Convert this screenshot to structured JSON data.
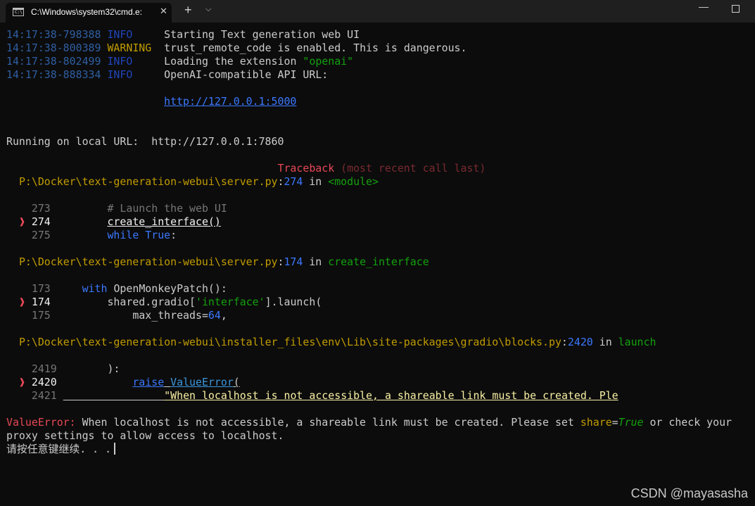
{
  "window": {
    "tab_title": "C:\\Windows\\system32\\cmd.e:",
    "tab_icon_text": "C:\\",
    "close_glyph": "✕",
    "newtab_glyph": "+",
    "dropdown_glyph": "⌵",
    "minimize_glyph": "—"
  },
  "log": [
    {
      "time": "14:17:38-798388",
      "level": "INFO",
      "msg": "Starting Text generation web UI"
    },
    {
      "time": "14:17:38-800389",
      "level": "WARNING",
      "msg": "trust_remote_code is enabled. This is dangerous."
    },
    {
      "time": "14:17:38-802499",
      "level": "INFO",
      "msg_prefix": "Loading the extension ",
      "msg_str": "\"openai\""
    },
    {
      "time": "14:17:38-888334",
      "level": "INFO",
      "msg": "OpenAI-compatible API URL:"
    }
  ],
  "api_url": "http://127.0.0.1:5000",
  "running": "Running on local URL:  http://127.0.0.1:7860",
  "traceback": {
    "title": "Traceback",
    "sub": "(most recent call last)"
  },
  "frames": [
    {
      "path": "P:\\Docker\\text-generation-webui\\server.py",
      "lineno": "274",
      "in": "in",
      "func": "<module>",
      "code": [
        {
          "n": "273",
          "text": "# Launch the web UI"
        },
        {
          "n": "274",
          "text": "create_interface()"
        },
        {
          "n": "275",
          "kw": "while",
          "rest": "True",
          "colon": ":"
        }
      ]
    },
    {
      "path": "P:\\Docker\\text-generation-webui\\server.py",
      "lineno": "174",
      "in": "in",
      "func": "create_interface",
      "code": [
        {
          "n": "173",
          "kw": "with",
          "rest": "OpenMonkeyPatch():"
        },
        {
          "n": "174",
          "a": "shared.gradio[",
          "s": "'interface'",
          "b": "].launch("
        },
        {
          "n": "175",
          "a": "max_threads=",
          "num": "64",
          "b": ","
        }
      ]
    },
    {
      "path": "P:\\Docker\\text-generation-webui\\installer_files\\env\\Lib\\site-packages\\gradio\\blocks.py",
      "lineno": "2420",
      "in": "in",
      "func": "launch",
      "code": [
        {
          "n": "2419",
          "text": "):"
        },
        {
          "n": "2420",
          "kw": "raise",
          "rest": "ValueError",
          "paren": "("
        },
        {
          "n": "2421",
          "text": "\"When localhost is not accessible, a shareable link must be created. Ple"
        }
      ]
    }
  ],
  "arrow": "❱",
  "error": {
    "type": "ValueError:",
    "msg1": " When localhost is not accessible, a shareable link must be created. Please set ",
    "share": "share",
    "eq": "=",
    "true": "True",
    "msg2": " or check your",
    "line2": "proxy settings to allow access to localhost."
  },
  "prompt": "请按任意键继续. . .",
  "watermark": "CSDN @mayasasha"
}
